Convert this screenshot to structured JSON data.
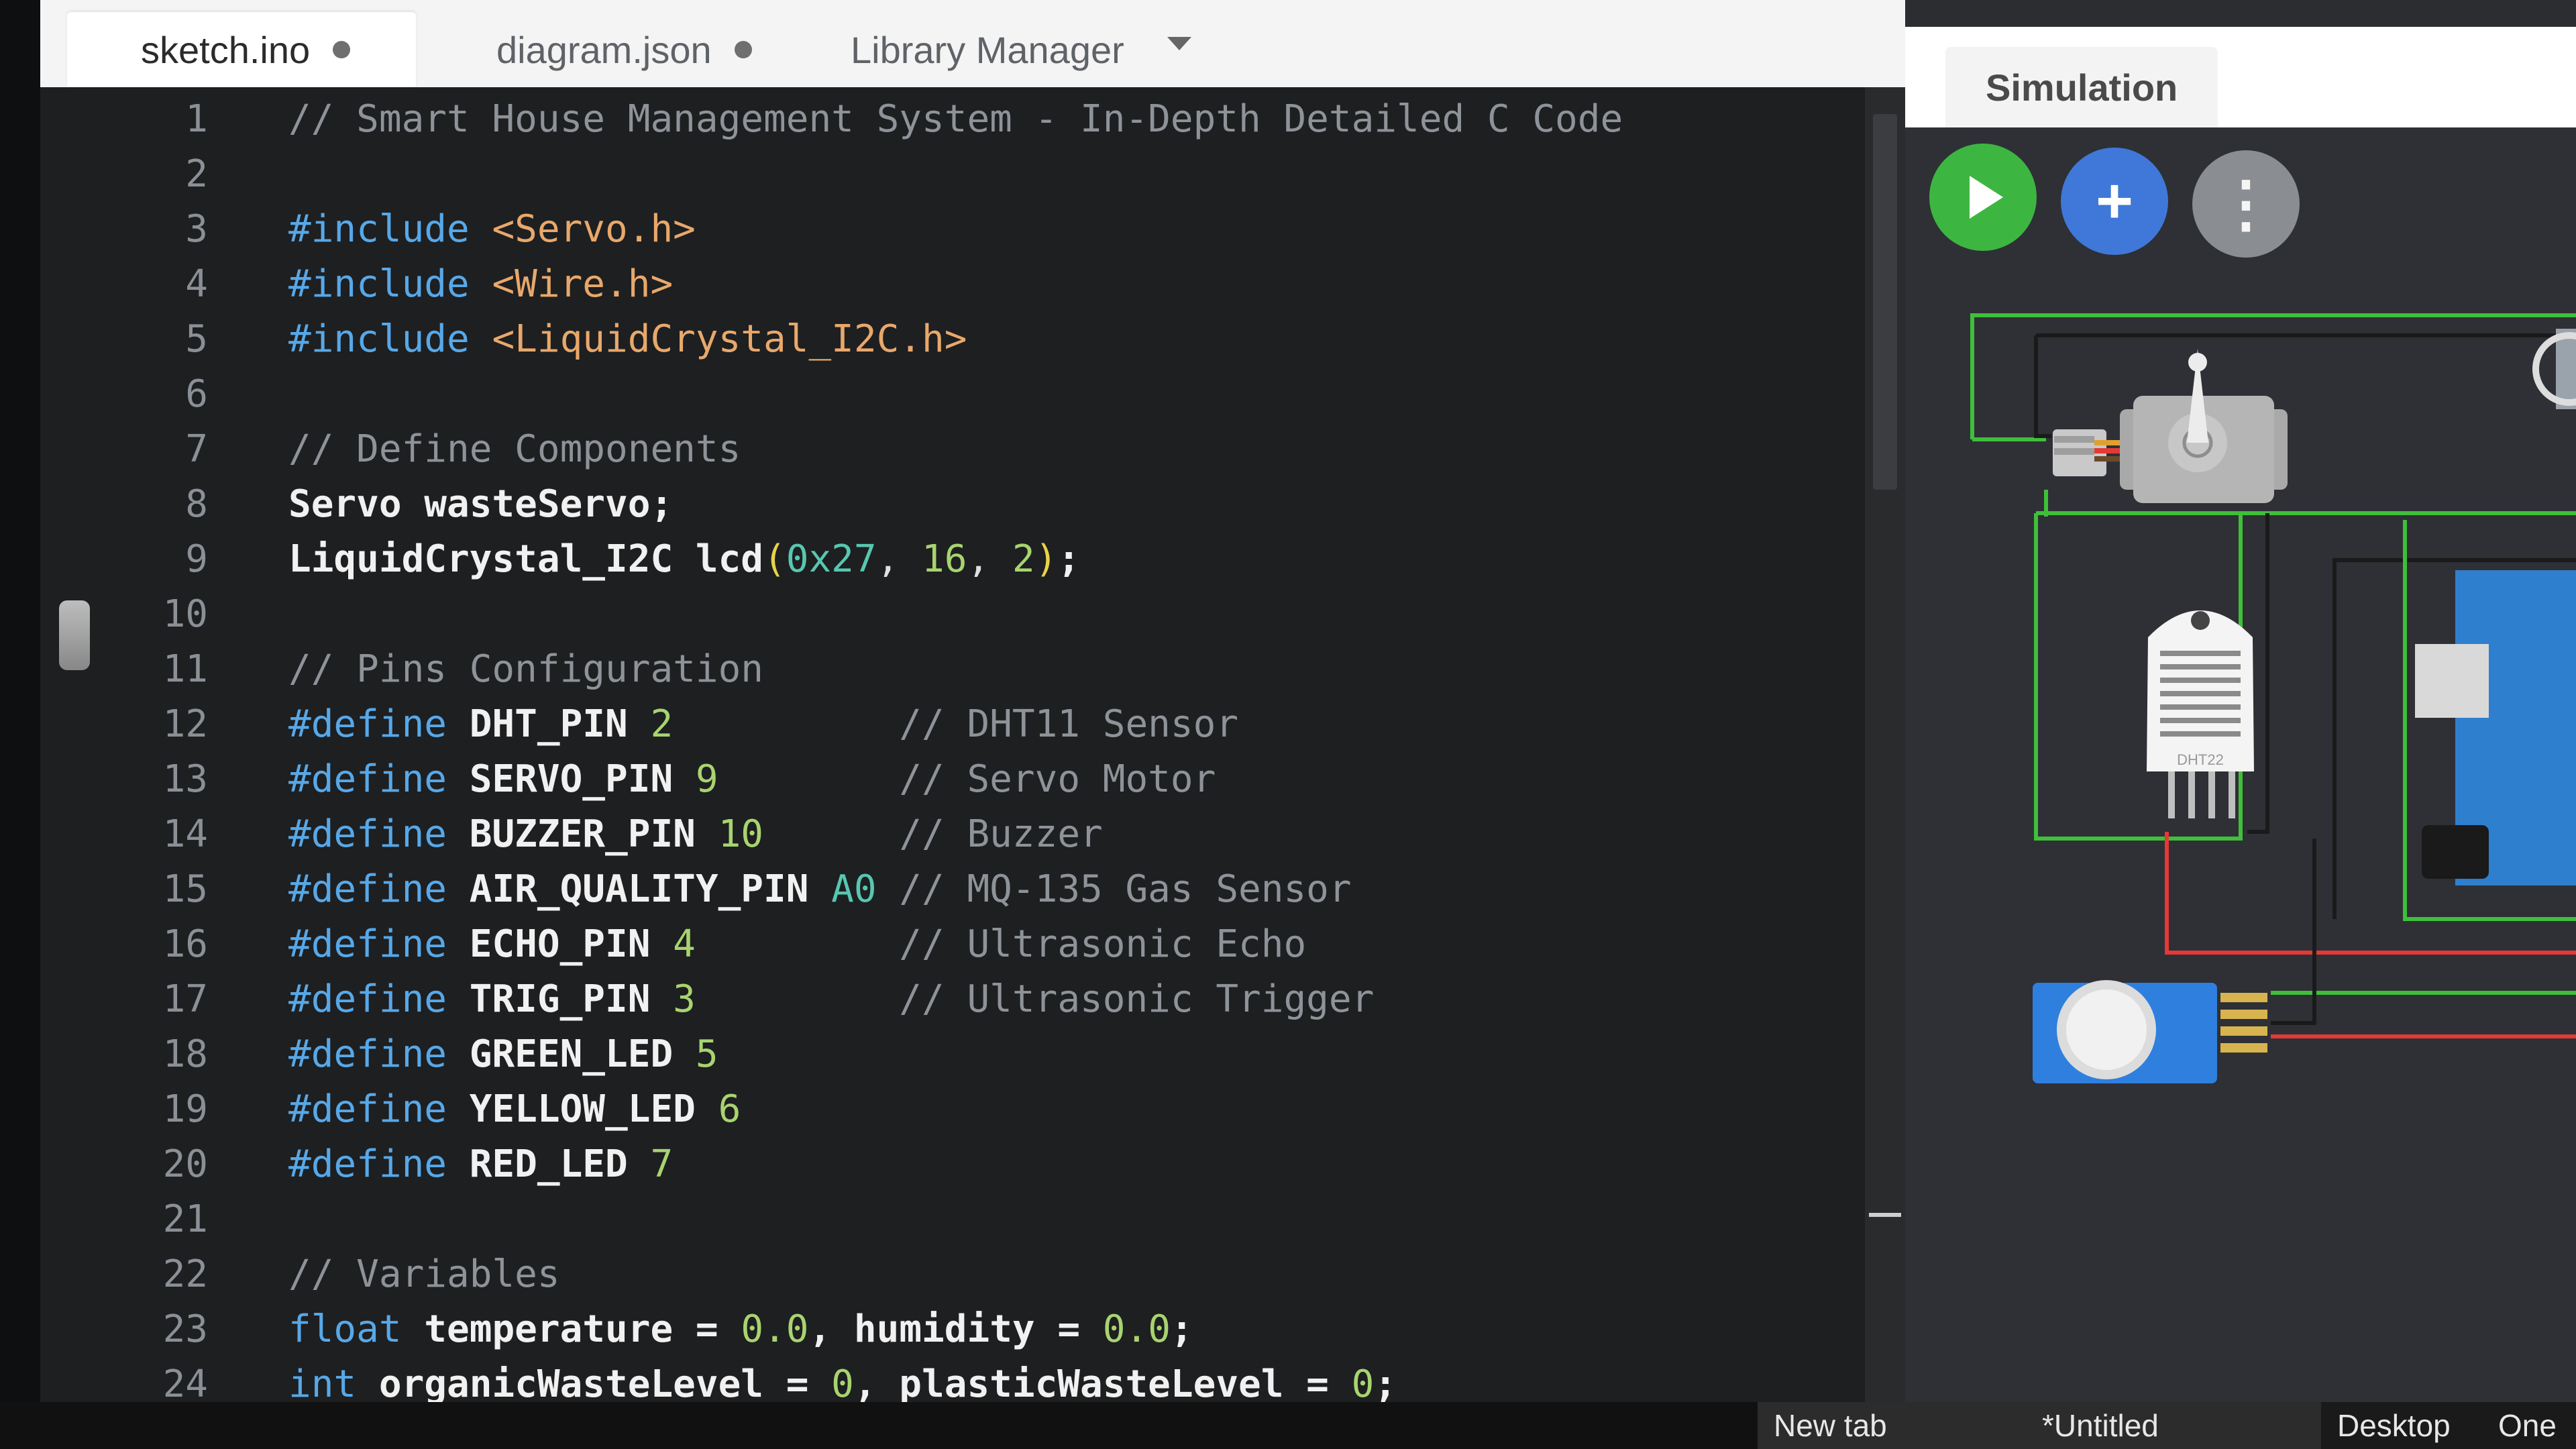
{
  "editor": {
    "tabs": [
      {
        "label": "sketch.ino",
        "active": true,
        "unsaved": true
      },
      {
        "label": "diagram.json",
        "active": false,
        "unsaved": true
      },
      {
        "label": "Library Manager",
        "active": false,
        "unsaved": false
      }
    ],
    "lines": [
      {
        "num": "1",
        "tokens": [
          {
            "t": "// Smart House Management System - In-Depth Detailed C Code",
            "c": "cm"
          }
        ]
      },
      {
        "num": "2",
        "tokens": []
      },
      {
        "num": "3",
        "tokens": [
          {
            "t": "#include ",
            "c": "kw"
          },
          {
            "t": "<Servo.h>",
            "c": "str"
          }
        ]
      },
      {
        "num": "4",
        "tokens": [
          {
            "t": "#include ",
            "c": "kw"
          },
          {
            "t": "<Wire.h>",
            "c": "str"
          }
        ]
      },
      {
        "num": "5",
        "tokens": [
          {
            "t": "#include ",
            "c": "kw"
          },
          {
            "t": "<LiquidCrystal_I2C.h>",
            "c": "str"
          }
        ]
      },
      {
        "num": "6",
        "tokens": []
      },
      {
        "num": "7",
        "tokens": [
          {
            "t": "// Define Components",
            "c": "cm"
          }
        ]
      },
      {
        "num": "8",
        "tokens": [
          {
            "t": "Servo wasteServo;",
            "c": "id"
          }
        ]
      },
      {
        "num": "9",
        "tokens": [
          {
            "t": "LiquidCrystal_I2C lcd",
            "c": "id"
          },
          {
            "t": "(",
            "c": "par"
          },
          {
            "t": "0x27",
            "c": "hex"
          },
          {
            "t": ", ",
            "c": "op"
          },
          {
            "t": "16",
            "c": "num"
          },
          {
            "t": ", ",
            "c": "op"
          },
          {
            "t": "2",
            "c": "num"
          },
          {
            "t": ")",
            "c": "par"
          },
          {
            "t": ";",
            "c": "id"
          }
        ]
      },
      {
        "num": "10",
        "tokens": []
      },
      {
        "num": "11",
        "tokens": [
          {
            "t": "// Pins Configuration",
            "c": "cm"
          }
        ]
      },
      {
        "num": "12",
        "tokens": [
          {
            "t": "#define ",
            "c": "kw"
          },
          {
            "t": "DHT_PIN ",
            "c": "id"
          },
          {
            "t": "2",
            "c": "num"
          },
          {
            "t": "          // DHT11 Sensor",
            "c": "cm"
          }
        ]
      },
      {
        "num": "13",
        "tokens": [
          {
            "t": "#define ",
            "c": "kw"
          },
          {
            "t": "SERVO_PIN ",
            "c": "id"
          },
          {
            "t": "9",
            "c": "num"
          },
          {
            "t": "        // Servo Motor",
            "c": "cm"
          }
        ]
      },
      {
        "num": "14",
        "tokens": [
          {
            "t": "#define ",
            "c": "kw"
          },
          {
            "t": "BUZZER_PIN ",
            "c": "id"
          },
          {
            "t": "10",
            "c": "num"
          },
          {
            "t": "      // Buzzer",
            "c": "cm"
          }
        ]
      },
      {
        "num": "15",
        "tokens": [
          {
            "t": "#define ",
            "c": "kw"
          },
          {
            "t": "AIR_QUALITY_PIN ",
            "c": "id"
          },
          {
            "t": "A0",
            "c": "hex"
          },
          {
            "t": " // MQ-135 Gas Sensor",
            "c": "cm"
          }
        ]
      },
      {
        "num": "16",
        "tokens": [
          {
            "t": "#define ",
            "c": "kw"
          },
          {
            "t": "ECHO_PIN ",
            "c": "id"
          },
          {
            "t": "4",
            "c": "num"
          },
          {
            "t": "         // Ultrasonic Echo",
            "c": "cm"
          }
        ]
      },
      {
        "num": "17",
        "tokens": [
          {
            "t": "#define ",
            "c": "kw"
          },
          {
            "t": "TRIG_PIN ",
            "c": "id"
          },
          {
            "t": "3",
            "c": "num"
          },
          {
            "t": "         // Ultrasonic Trigger",
            "c": "cm"
          }
        ]
      },
      {
        "num": "18",
        "tokens": [
          {
            "t": "#define ",
            "c": "kw"
          },
          {
            "t": "GREEN_LED ",
            "c": "id"
          },
          {
            "t": "5",
            "c": "num"
          }
        ]
      },
      {
        "num": "19",
        "tokens": [
          {
            "t": "#define ",
            "c": "kw"
          },
          {
            "t": "YELLOW_LED ",
            "c": "id"
          },
          {
            "t": "6",
            "c": "num"
          }
        ]
      },
      {
        "num": "20",
        "tokens": [
          {
            "t": "#define ",
            "c": "kw"
          },
          {
            "t": "RED_LED ",
            "c": "id"
          },
          {
            "t": "7",
            "c": "num"
          }
        ]
      },
      {
        "num": "21",
        "tokens": []
      },
      {
        "num": "22",
        "tokens": [
          {
            "t": "// Variables",
            "c": "cm"
          }
        ]
      },
      {
        "num": "23",
        "tokens": [
          {
            "t": "float ",
            "c": "kw"
          },
          {
            "t": "temperature = ",
            "c": "id"
          },
          {
            "t": "0.0",
            "c": "num"
          },
          {
            "t": ", humidity = ",
            "c": "id"
          },
          {
            "t": "0.0",
            "c": "num"
          },
          {
            "t": ";",
            "c": "id"
          }
        ]
      },
      {
        "num": "24",
        "tokens": [
          {
            "t": "int ",
            "c": "kw"
          },
          {
            "t": "organicWasteLevel = ",
            "c": "id"
          },
          {
            "t": "0",
            "c": "num"
          },
          {
            "t": ", plasticWasteLevel = ",
            "c": "id"
          },
          {
            "t": "0",
            "c": "num"
          },
          {
            "t": ";",
            "c": "id"
          }
        ]
      }
    ]
  },
  "simulation": {
    "tab_label": "Simulation",
    "sensor_label": "DHT22",
    "wire_colors": {
      "green": "#3fbf3a",
      "red": "#e53935",
      "black": "#1a1a1a"
    }
  },
  "taskbar": {
    "items": [
      "New tab",
      "*Untitled",
      "Desktop",
      "One"
    ]
  },
  "colors": {
    "editor_bg": "#1e1f21",
    "keyword": "#57a8e8",
    "string": "#e8a86b",
    "number": "#a8d46f",
    "comment": "#8e9399",
    "play_button": "#3db641",
    "add_button": "#3f78d8",
    "more_button": "#8a8d91"
  }
}
